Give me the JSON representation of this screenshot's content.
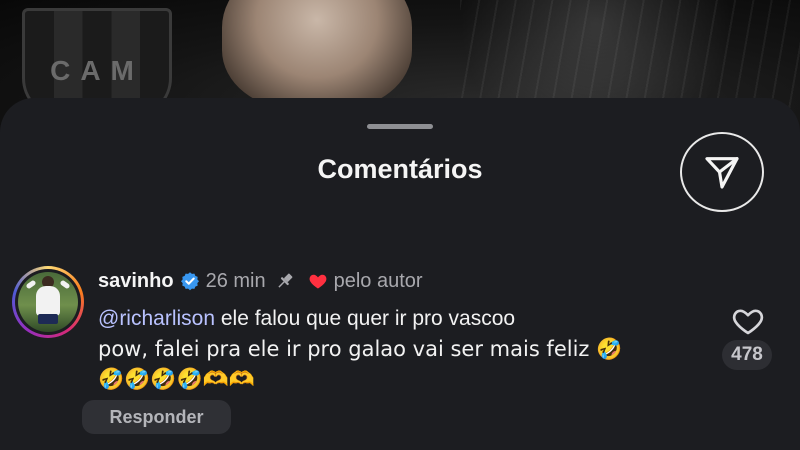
{
  "background": {
    "crest_text": "CAM"
  },
  "sheet": {
    "title": "Comentários"
  },
  "comment": {
    "username": "savinho",
    "time": "26 min",
    "author_liked": "pelo autor",
    "mention": "@richarlison",
    "text_line1": " ele falou que quer ir pro vascoo",
    "text_line2": "pow, falei pra ele ir pro galao vai ser mais feliz 🤣",
    "text_line3": "🤣🤣🤣🤣🫶🫶",
    "like_count": "478",
    "reply_label": "Responder"
  },
  "colors": {
    "sheet_bg": "#1c1d21",
    "mention": "#b9c2ff",
    "verified": "#3897f0",
    "heart_red": "#ff3040"
  },
  "icons": [
    "share-icon",
    "verified-icon",
    "pin-icon",
    "heart-filled-icon",
    "heart-outline-icon"
  ]
}
